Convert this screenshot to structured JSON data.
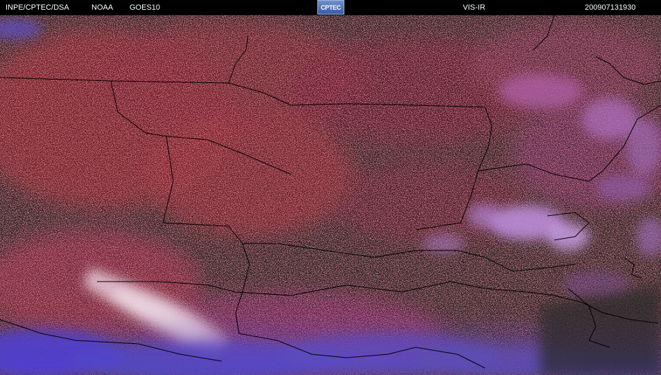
{
  "header": {
    "organization": "INPE/CPTEC/DSA",
    "agency": "NOAA",
    "satellite": "GOES10",
    "channel": "VIS-IR",
    "timestamp": "200907131930",
    "logo_text": "CPTEC"
  },
  "colors": {
    "background": "#000000",
    "land_dark": "#2a2a2a",
    "cold_cloud_red": "#c0303c",
    "high_cloud_magenta": "#b050a8",
    "thick_cloud_lavender": "#c8a8e8",
    "low_cloud_blue": "#5050d0",
    "border_lines": "#000000"
  }
}
